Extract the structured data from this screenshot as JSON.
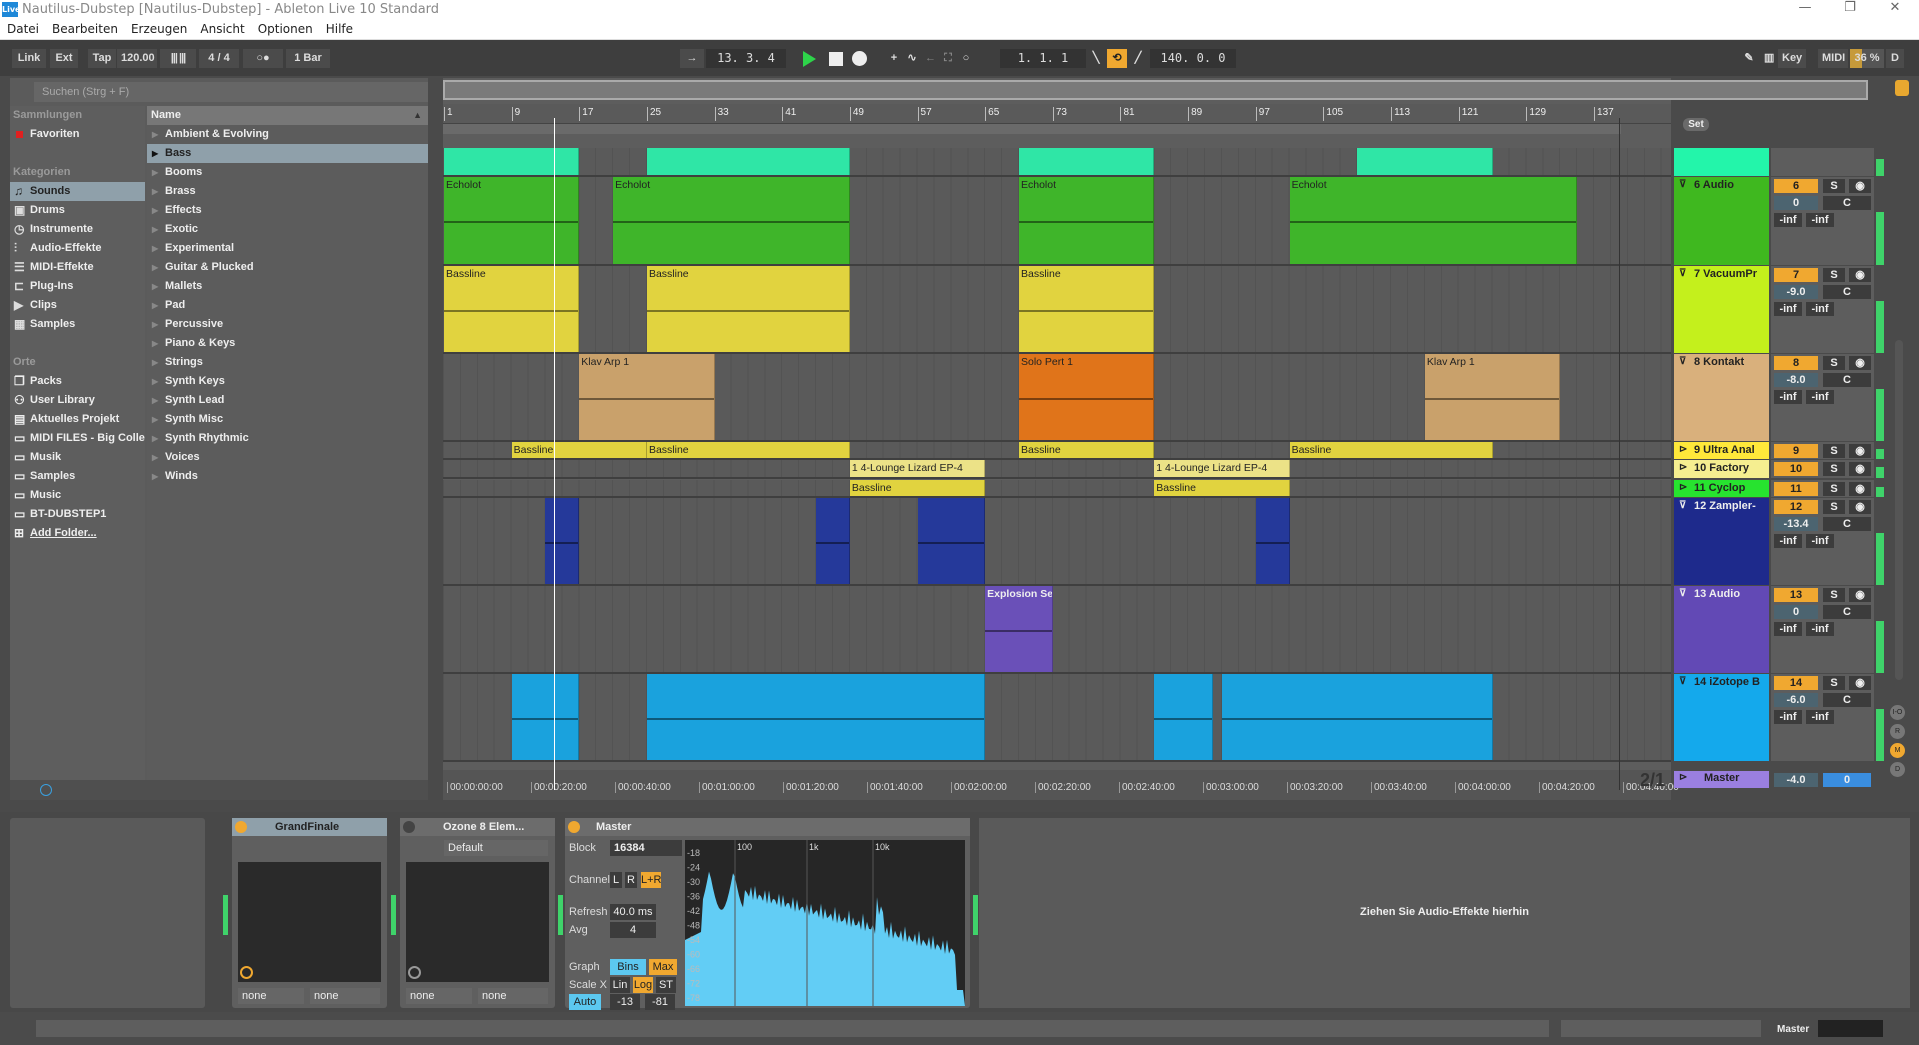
{
  "window": {
    "title": "Nautilus-Dubstep  [Nautilus-Dubstep] - Ableton Live 10 Standard",
    "logo": "Live"
  },
  "menu": [
    "Datei",
    "Bearbeiten",
    "Erzeugen",
    "Ansicht",
    "Optionen",
    "Hilfe"
  ],
  "toolbar": {
    "link": "Link",
    "ext": "Ext",
    "tap": "Tap",
    "tempo": "120.00",
    "signature": "4 / 4",
    "metronome": "○●",
    "quantize": "1 Bar",
    "position": "13.  3.  4",
    "loop_start": "1.  1.  1",
    "loop_length": "140.  0.  0",
    "key": "Key",
    "midi": "MIDI",
    "cpu": "36 %",
    "disk": "D"
  },
  "browser": {
    "search_placeholder": "Suchen (Strg + F)",
    "collections_header": "Sammlungen",
    "favorites": "Favoriten",
    "categories_header": "Kategorien",
    "categories": [
      {
        "label": "Sounds",
        "icon": "music-note-icon",
        "selected": true
      },
      {
        "label": "Drums",
        "icon": "drum-pads-icon"
      },
      {
        "label": "Instrumente",
        "icon": "instrument-icon"
      },
      {
        "label": "Audio-Effekte",
        "icon": "audio-effect-icon"
      },
      {
        "label": "MIDI-Effekte",
        "icon": "midi-effect-icon"
      },
      {
        "label": "Plug-Ins",
        "icon": "plugin-icon"
      },
      {
        "label": "Clips",
        "icon": "clip-icon"
      },
      {
        "label": "Samples",
        "icon": "sample-icon"
      }
    ],
    "places_header": "Orte",
    "places": [
      {
        "label": "Packs",
        "icon": "packs-icon"
      },
      {
        "label": "User Library",
        "icon": "user-icon"
      },
      {
        "label": "Aktuelles Projekt",
        "icon": "project-folder-icon"
      },
      {
        "label": "MIDI FILES - Big Collec",
        "icon": "folder-icon"
      },
      {
        "label": "Musik",
        "icon": "folder-icon"
      },
      {
        "label": "Samples",
        "icon": "folder-icon"
      },
      {
        "label": "Music",
        "icon": "folder-icon"
      },
      {
        "label": "BT-DUBSTEP1",
        "icon": "folder-icon"
      },
      {
        "label": "Add Folder...",
        "icon": "add-folder-icon"
      }
    ],
    "name_header": "Name",
    "items": [
      "Ambient & Evolving",
      "Bass",
      "Booms",
      "Brass",
      "Effects",
      "Exotic",
      "Experimental",
      "Guitar & Plucked",
      "Mallets",
      "Pad",
      "Percussive",
      "Piano & Keys",
      "Strings",
      "Synth Keys",
      "Synth Lead",
      "Synth Misc",
      "Synth Rhythmic",
      "Voices",
      "Winds"
    ],
    "selected_item": "Bass"
  },
  "arrangement": {
    "bar_labels": [
      "1",
      "9",
      "17",
      "25",
      "33",
      "41",
      "49",
      "57",
      "65",
      "73",
      "81",
      "89",
      "97",
      "105",
      "113",
      "121",
      "129",
      "137"
    ],
    "time_labels": [
      "00:00:00:00",
      "00:00:20:00",
      "00:00:40:00",
      "00:01:00:00",
      "00:01:20:00",
      "00:01:40:00",
      "00:02:00:00",
      "00:02:20:00",
      "00:02:40:00",
      "00:03:00:00",
      "00:03:20:00",
      "00:03:40:00",
      "00:04:00:00",
      "00:04:20:00",
      "00:04:40:00"
    ],
    "set_label": "Set",
    "zoom_ratio": "2/1",
    "playhead_bar": 14.0,
    "loop_end_bar": 140,
    "tracks": [
      {
        "name": "",
        "color": "#23f5aa",
        "clip_color": "#2fe6a6",
        "h": "small0",
        "clips": [
          {
            "s": 1,
            "e": 17
          },
          {
            "s": 25,
            "e": 49
          },
          {
            "s": 69,
            "e": 85
          },
          {
            "s": 109,
            "e": 125
          }
        ]
      },
      {
        "name": "6 Audio",
        "color": "#3fb81f",
        "clip_color": "#3fb52a",
        "h": "big",
        "num": "6",
        "vol": "0",
        "pan": "C",
        "peak": [
          "-inf",
          "-inf"
        ],
        "clips": [
          {
            "s": 1,
            "e": 17,
            "name": "Echolot"
          },
          {
            "s": 21,
            "e": 49,
            "name": "Echolot"
          },
          {
            "s": 69,
            "e": 85,
            "name": "Echolot"
          },
          {
            "s": 101,
            "e": 135,
            "name": "Echolot"
          }
        ]
      },
      {
        "name": "7 VacuumPr",
        "color": "#c4f01c",
        "clip_color": "#e1d33f",
        "h": "big",
        "num": "7",
        "vol": "-9.0",
        "pan": "C",
        "peak": [
          "-inf",
          "-inf"
        ],
        "clips": [
          {
            "s": 1,
            "e": 17,
            "name": "Bassline"
          },
          {
            "s": 25,
            "e": 49,
            "name": "Bassline"
          },
          {
            "s": 69,
            "e": 85,
            "name": "Bassline"
          }
        ]
      },
      {
        "name": "8 Kontakt",
        "color": "#d9b07c",
        "clip_color": "#c9a16b",
        "h": "big",
        "num": "8",
        "vol": "-8.0",
        "pan": "C",
        "peak": [
          "-inf",
          "-inf"
        ],
        "clips": [
          {
            "s": 17,
            "e": 33,
            "name": "Klav Arp 1"
          },
          {
            "s": 69,
            "e": 85,
            "name": "Solo Pert 1",
            "color": "#e0741a"
          },
          {
            "s": 117,
            "e": 133,
            "name": "Klav Arp 1"
          }
        ]
      },
      {
        "name": "9 Ultra Anal",
        "color": "#ffe83a",
        "clip_color": "#e1d33f",
        "h": "small",
        "num": "9",
        "clips": [
          {
            "s": 9,
            "e": 25,
            "name": "Bassline"
          },
          {
            "s": 25,
            "e": 49,
            "name": "Bassline"
          },
          {
            "s": 69,
            "e": 85,
            "name": "Bassline"
          },
          {
            "s": 101,
            "e": 125,
            "name": "Bassline"
          }
        ]
      },
      {
        "name": "10 Factory",
        "color": "#f5ee90",
        "clip_color": "#ece287",
        "h": "small",
        "num": "10",
        "clips": [
          {
            "s": 49,
            "e": 65,
            "name": "1 4-Lounge Lizard EP-4"
          },
          {
            "s": 85,
            "e": 101,
            "name": "1 4-Lounge Lizard EP-4"
          }
        ]
      },
      {
        "name": "11 Cyclop",
        "color": "#27e32f",
        "clip_color": "#e1d33f",
        "h": "small",
        "num": "11",
        "clips": [
          {
            "s": 49,
            "e": 65,
            "name": "Bassline"
          },
          {
            "s": 85,
            "e": 101,
            "name": "Bassline"
          }
        ]
      },
      {
        "name": "12 Zampler-",
        "color": "#1e2a8c",
        "clip_color": "#25399a",
        "h": "big",
        "light": true,
        "num": "12",
        "vol": "-13.4",
        "pan": "C",
        "peak": [
          "-inf",
          "-inf"
        ],
        "clips": [
          {
            "s": 13,
            "e": 17
          },
          {
            "s": 45,
            "e": 49
          },
          {
            "s": 57,
            "e": 65
          },
          {
            "s": 97,
            "e": 101
          }
        ]
      },
      {
        "name": "13 Audio",
        "color": "#6249b5",
        "clip_color": "#6a50b8",
        "h": "big",
        "light": true,
        "num": "13",
        "vol": "0",
        "pan": "C",
        "peak": [
          "-inf",
          "-inf"
        ],
        "clips": [
          {
            "s": 65,
            "e": 73,
            "name": "Explosion Ser"
          }
        ]
      },
      {
        "name": "14 iZotope B",
        "color": "#14a9ec",
        "clip_color": "#1aa2dd",
        "h": "big",
        "num": "14",
        "vol": "-6.0",
        "pan": "C",
        "peak": [
          "-inf",
          "-inf"
        ],
        "clips": [
          {
            "s": 9,
            "e": 17
          },
          {
            "s": 25,
            "e": 65
          },
          {
            "s": 85,
            "e": 92
          },
          {
            "s": 93,
            "e": 125
          }
        ]
      }
    ],
    "master": {
      "name": "Master",
      "color": "#9a7fe0",
      "vol": "-4.0",
      "pan": "0"
    }
  },
  "side_buttons": [
    "I-O",
    "R",
    "M",
    "D"
  ],
  "devices": {
    "grandfinale": {
      "title": "GrandFinale",
      "sel1": "none",
      "sel2": "none"
    },
    "ozone": {
      "title": "Ozone 8 Elem...",
      "preset": "Default",
      "sel1": "none",
      "sel2": "none"
    },
    "master": {
      "title": "Master",
      "block_label": "Block",
      "block": "16384",
      "channel_label": "Channel",
      "ch": [
        "L",
        "R",
        "L+R"
      ],
      "refresh_label": "Refresh",
      "refresh": "40.0 ms",
      "avg_label": "Avg",
      "avg": "4",
      "graph_label": "Graph",
      "graph": [
        "Bins",
        "Max"
      ],
      "scalex_label": "Scale X",
      "scalex": [
        "Lin",
        "Log",
        "ST"
      ],
      "auto": "Auto",
      "range_lo": "-13",
      "range_hi": "-81",
      "freq_labels": [
        "100",
        "1k",
        "10k"
      ],
      "db_labels": [
        "-18",
        "-24",
        "-30",
        "-36",
        "-42",
        "-48",
        "-54",
        "-60",
        "-66",
        "-72",
        "-78"
      ]
    },
    "drop_hint": "Ziehen Sie Audio-Effekte hierhin"
  },
  "status": {
    "master": "Master"
  }
}
